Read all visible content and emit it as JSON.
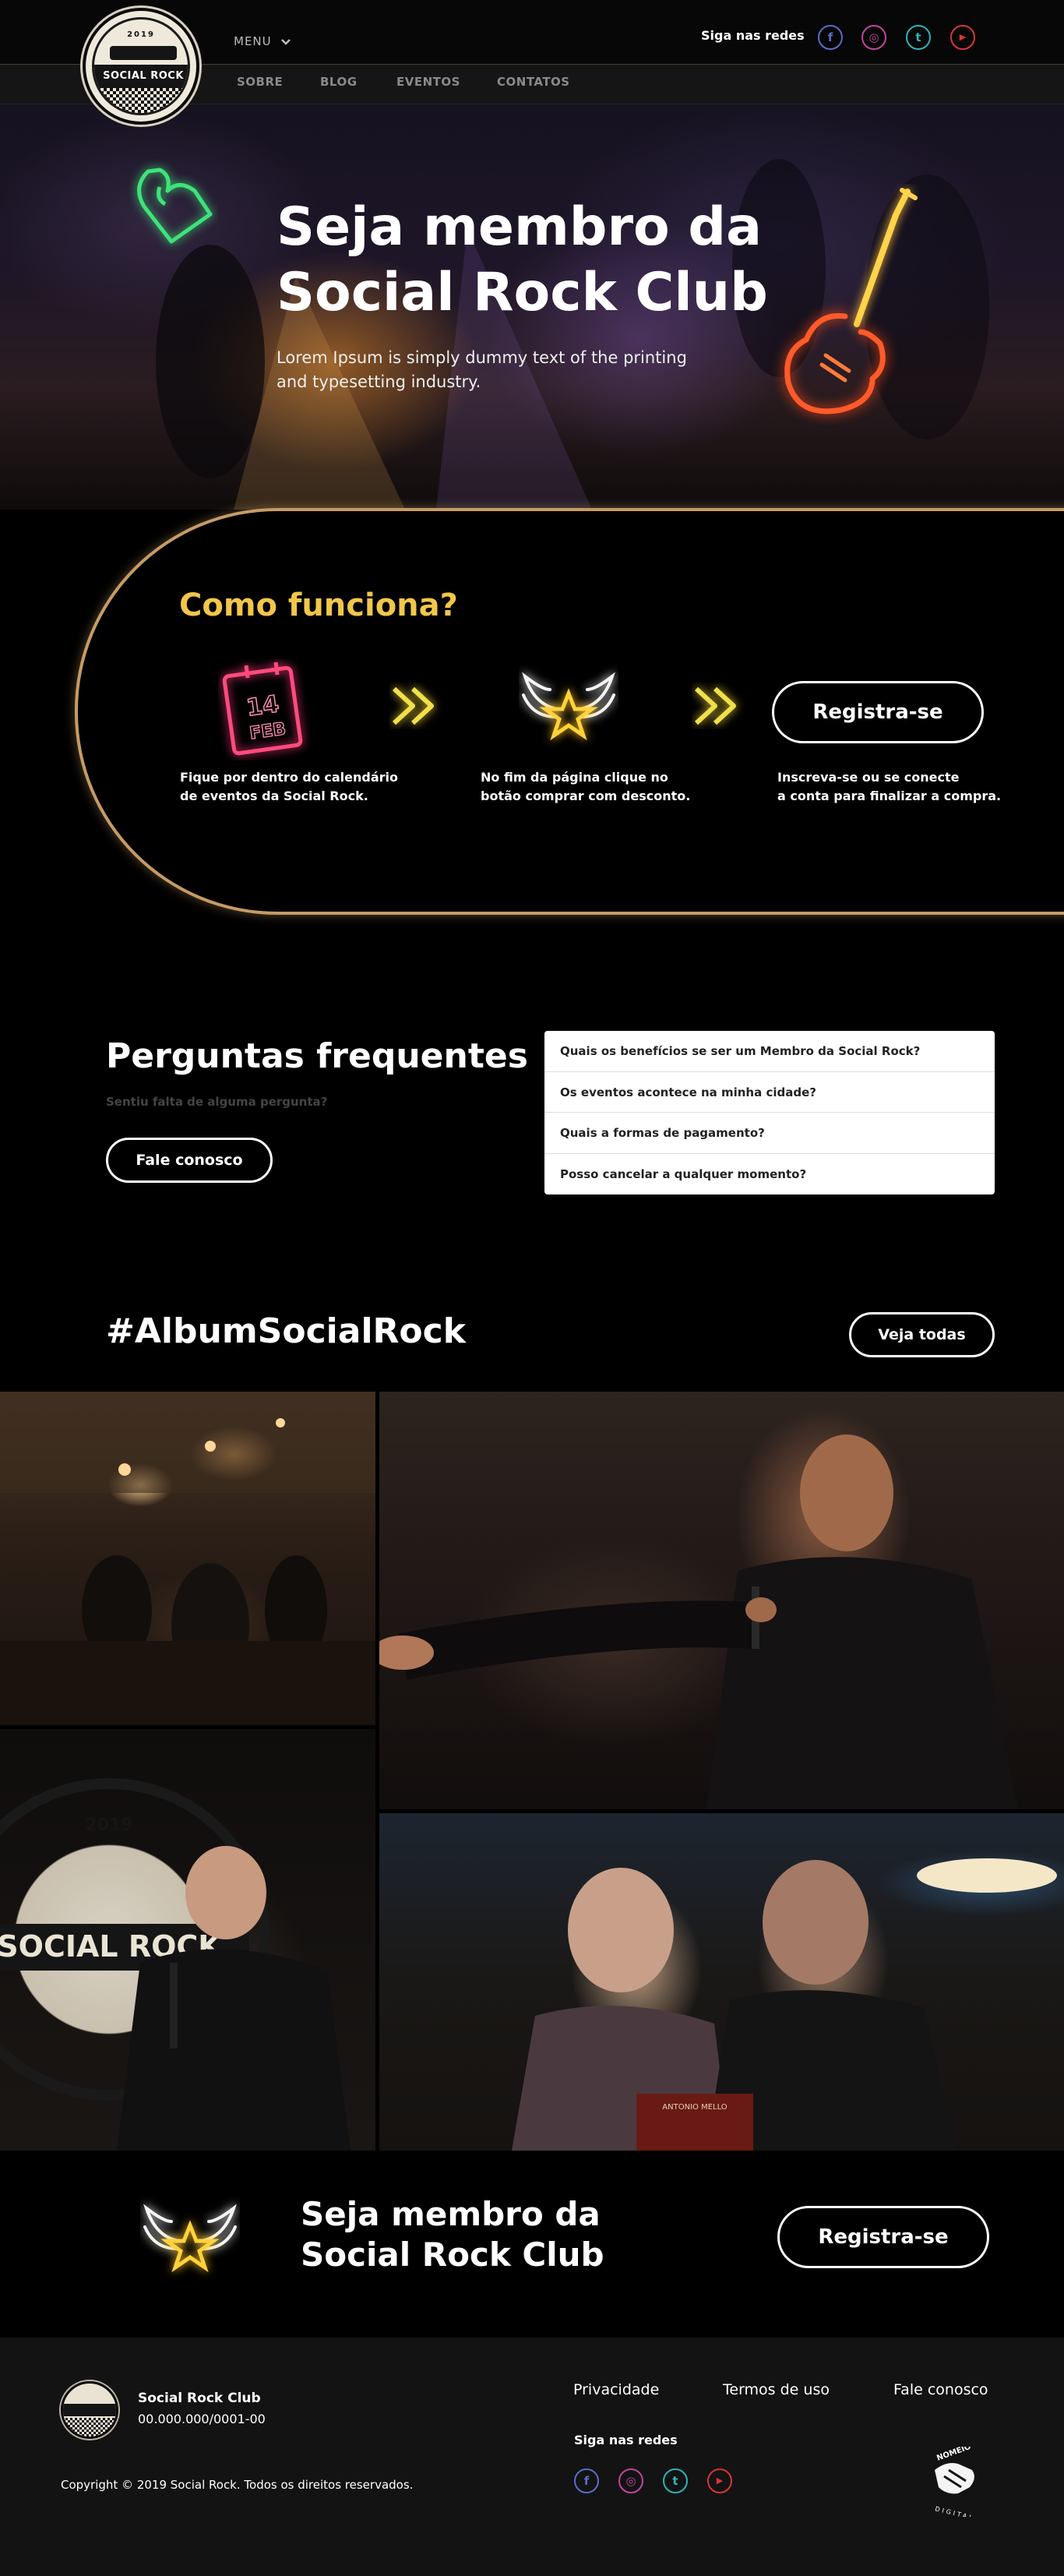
{
  "header": {
    "brand": "SOCIAL ROCK CLUB",
    "brand_year": "2019",
    "menu_label": "MENU",
    "nav": [
      "SOBRE",
      "BLOG",
      "EVENTOS",
      "CONTATOS"
    ],
    "follow_label": "Siga nas redes",
    "social": [
      {
        "icon": "facebook-icon",
        "glyph": "f",
        "color": "#5b6cc8"
      },
      {
        "icon": "instagram-icon",
        "glyph": "◎",
        "color": "#c2459e"
      },
      {
        "icon": "twitter-icon",
        "glyph": "t",
        "color": "#2db5b8"
      },
      {
        "icon": "youtube-icon",
        "glyph": "▶",
        "color": "#d7353a"
      }
    ]
  },
  "hero": {
    "title_line1": "Seja membro da",
    "title_line2": "Social Rock Club",
    "subtitle_line1": "Lorem Ipsum is simply dummy text of the printing",
    "subtitle_line2": "and typesetting industry."
  },
  "how": {
    "title": "Como funciona?",
    "calendar_day": "14",
    "calendar_month": "FEB",
    "steps": [
      {
        "line1": "Fique por dentro do calendário",
        "line2": "de eventos da Social Rock."
      },
      {
        "line1": "No fim da página clique no",
        "line2": "botão comprar com desconto."
      },
      {
        "line1": "Inscreva-se ou se conecte",
        "line2": "a conta para finalizar a compra."
      }
    ],
    "register_label": "Registra-se"
  },
  "faq": {
    "title": "Perguntas frequentes",
    "subtitle": "Sentiu falta de alguma pergunta?",
    "contact_label": "Fale conosco",
    "items": [
      "Quais os benefícios se ser um Membro da Social Rock?",
      "Os eventos acontece na minha cidade?",
      "Quais a formas de pagamento?",
      "Posso cancelar a qualquer momento?"
    ]
  },
  "album": {
    "title": "#AlbumSocialRock",
    "see_all_label": "Veja todas",
    "photo3_badge_year": "2019",
    "photo3_badge_text": "SOCIAL ROCK",
    "photo4_book_text": "ANTONIO MELLO"
  },
  "cta": {
    "title_line1": "Seja membro da",
    "title_line2": "Social Rock Club",
    "register_label": "Registra-se"
  },
  "footer": {
    "company": "Social Rock Club",
    "cnpj": "00.000.000/0001-00",
    "links": [
      "Privacidade",
      "Termos de uso",
      "Fale conosco"
    ],
    "follow_label": "Siga nas redes",
    "copyright": "Copyright © 2019 Social Rock. Todos os direitos reservados.",
    "agency_top": "NOMEIO",
    "agency_bottom": "DIGITAL"
  }
}
